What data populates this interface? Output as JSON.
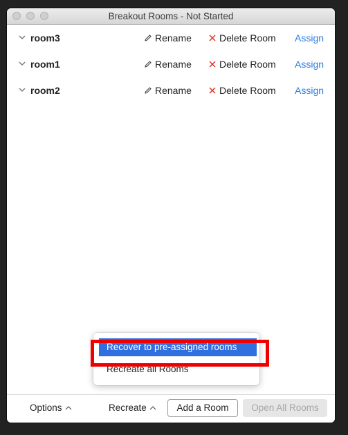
{
  "window": {
    "title": "Breakout Rooms - Not Started"
  },
  "rooms": [
    {
      "name": "room3",
      "rename": "Rename",
      "delete": "Delete Room",
      "assign": "Assign"
    },
    {
      "name": "room1",
      "rename": "Rename",
      "delete": "Delete Room",
      "assign": "Assign"
    },
    {
      "name": "room2",
      "rename": "Rename",
      "delete": "Delete Room",
      "assign": "Assign"
    }
  ],
  "bottom": {
    "options": "Options",
    "recreate": "Recreate",
    "add_room": "Add a Room",
    "open_all": "Open All Rooms"
  },
  "recreate_menu": {
    "items": [
      "Recover to pre-assigned rooms",
      "Recreate all Rooms"
    ],
    "selected_index": 0
  },
  "colors": {
    "link": "#2d7be0",
    "delete_icon": "#e0352b",
    "menu_selected": "#2f6fe0",
    "annotation": "#ee0000"
  },
  "icons": {
    "chevron": "chevron-down-icon",
    "rename": "pencil-icon",
    "delete": "close-icon",
    "menu_caret": "chevron-up-icon"
  }
}
